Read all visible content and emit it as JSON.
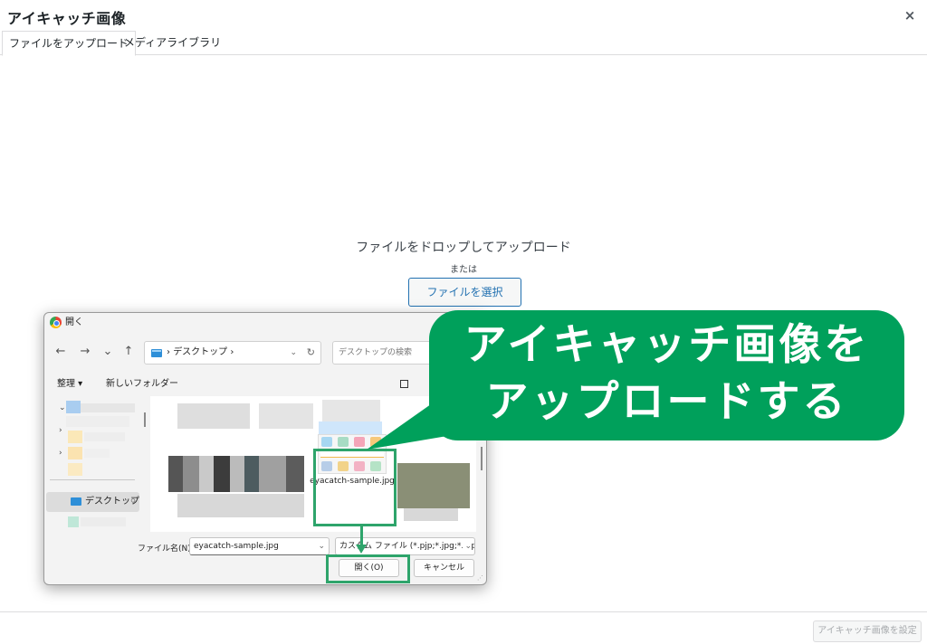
{
  "modal": {
    "title": "アイキャッチ画像",
    "close_glyph": "×",
    "tabs": [
      {
        "label": "ファイルをアップロード",
        "active": true
      },
      {
        "label": "メディアライブラリ",
        "active": false
      }
    ]
  },
  "upload": {
    "drop_text": "ファイルをドロップしてアップロード",
    "or_text": "または",
    "select_button": "ファイルを選択"
  },
  "footer": {
    "set_button": "アイキャッチ画像を設定"
  },
  "dialog": {
    "title": "開く",
    "nav": {
      "back": "←",
      "forward": "→",
      "recent": "⌄",
      "up": "↑"
    },
    "address": {
      "separator": "›",
      "folder": "デスクトップ",
      "trail": "›",
      "dropdown": "⌄",
      "refresh": "↻"
    },
    "search_placeholder": "デスクトップの検索",
    "toolbar": {
      "organize": "整理 ▾",
      "new_folder": "新しいフォルダー"
    },
    "sidebar": {
      "desktop_label": "デスクトップ",
      "pin": "📌"
    },
    "file": {
      "caption": "eyacatch-sample.jpg"
    },
    "filename_label": "ファイル名(N):",
    "filename_value": "eyacatch-sample.jpg",
    "filetype_value": "カスタム ファイル (*.pjp;*.jpg;*.pjpeg",
    "open_button": "開く(O)",
    "cancel_button": "キャンセル"
  },
  "callout": {
    "line1": "アイキャッチ画像を",
    "line2": "アップロードする"
  },
  "colors": {
    "accent_green": "#00a05b",
    "wp_blue": "#2271b1"
  }
}
